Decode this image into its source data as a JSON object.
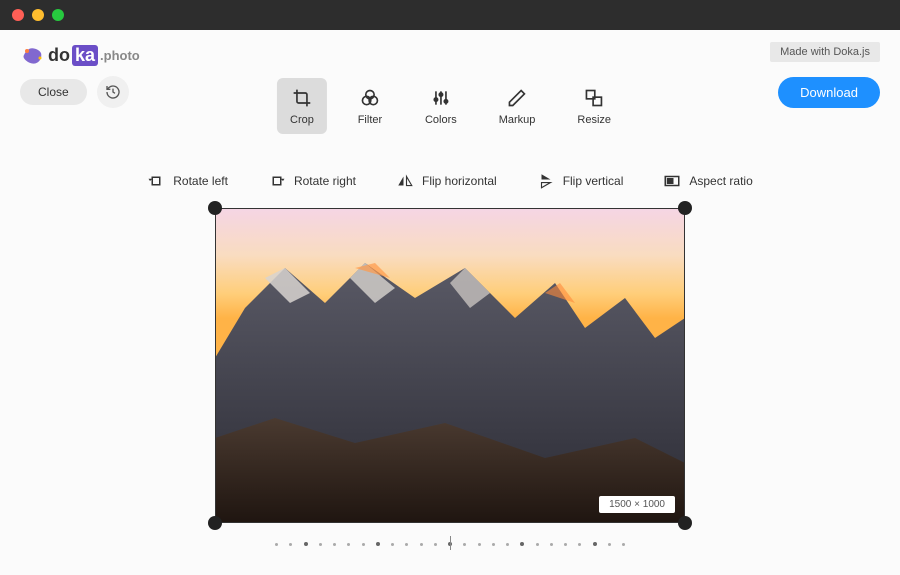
{
  "branding": {
    "logo_part1": "do",
    "logo_part2": "ka",
    "logo_suffix": ".photo",
    "made_with": "Made with Doka.js"
  },
  "header": {
    "close_label": "Close",
    "download_label": "Download"
  },
  "tools": [
    {
      "id": "crop",
      "label": "Crop",
      "active": true
    },
    {
      "id": "filter",
      "label": "Filter",
      "active": false
    },
    {
      "id": "colors",
      "label": "Colors",
      "active": false
    },
    {
      "id": "markup",
      "label": "Markup",
      "active": false
    },
    {
      "id": "resize",
      "label": "Resize",
      "active": false
    }
  ],
  "crop_subtools": {
    "rotate_left": "Rotate left",
    "rotate_right": "Rotate right",
    "flip_horizontal": "Flip horizontal",
    "flip_vertical": "Flip vertical",
    "aspect_ratio": "Aspect ratio"
  },
  "canvas": {
    "dimensions_label": "1500 × 1000"
  },
  "colors": {
    "accent": "#1e90ff",
    "titlebar": "#2d2d2d"
  }
}
